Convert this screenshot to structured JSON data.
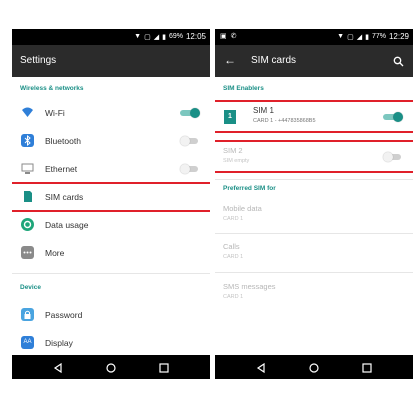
{
  "left": {
    "status": {
      "battery": "69%",
      "time": "12:05"
    },
    "title": "Settings",
    "section_wireless": "Wireless & networks",
    "items": [
      {
        "label": "Wi-Fi"
      },
      {
        "label": "Bluetooth"
      },
      {
        "label": "Ethernet"
      },
      {
        "label": "SIM cards"
      },
      {
        "label": "Data usage"
      },
      {
        "label": "More"
      }
    ],
    "section_device": "Device",
    "device_items": [
      {
        "label": "Password"
      },
      {
        "label": "Display",
        "icon_text": "AA"
      }
    ],
    "toggles": {
      "wifi": true,
      "bluetooth": false,
      "ethernet": false
    }
  },
  "right": {
    "status": {
      "battery": "77%",
      "time": "12:29"
    },
    "title": "SIM cards",
    "section_enablers": "SIM Enablers",
    "sim1": {
      "title": "SIM 1",
      "sub": "CARD 1 - +447835868B5",
      "enabled": true
    },
    "sim2": {
      "title": "SIM 2",
      "sub": "SIM empty",
      "enabled": false
    },
    "section_preferred": "Preferred SIM for",
    "preferred": [
      {
        "title": "Mobile data",
        "sub": "CARD 1"
      },
      {
        "title": "Calls",
        "sub": "CARD 1"
      },
      {
        "title": "SMS messages",
        "sub": "CARD 1"
      }
    ]
  },
  "colors": {
    "accent": "#1a8f86",
    "highlight": "#e0202a",
    "appbar": "#2b2b2b"
  }
}
